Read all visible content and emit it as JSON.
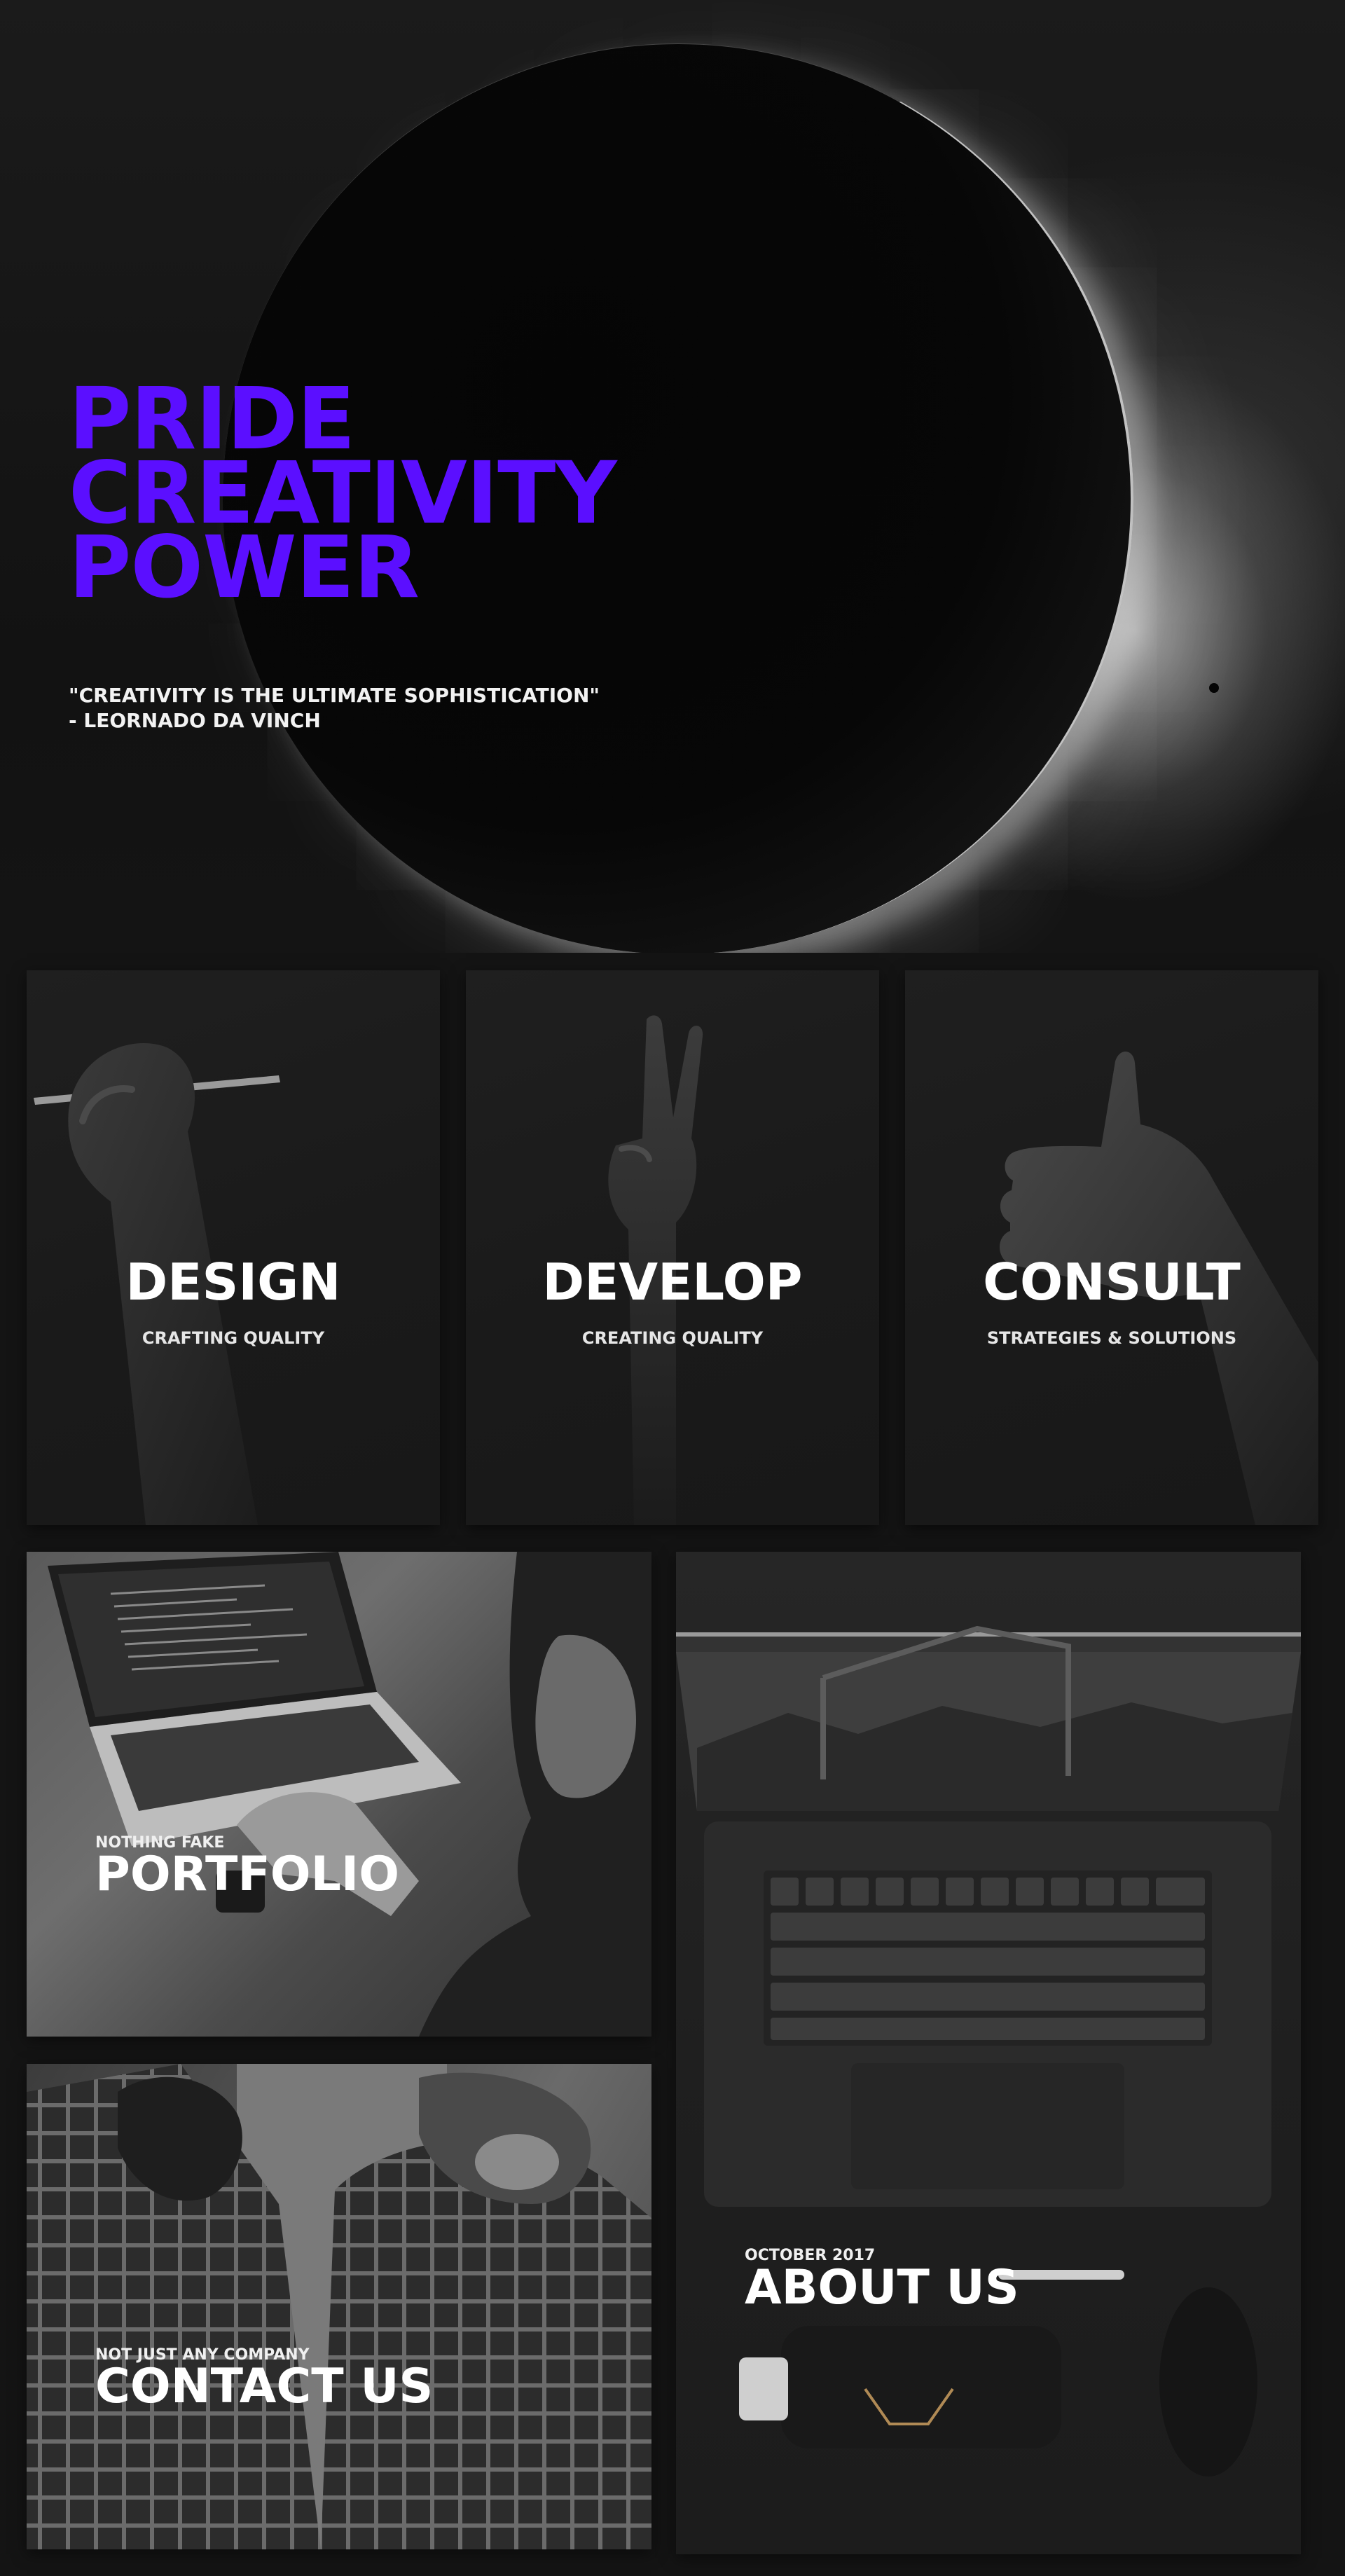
{
  "hero": {
    "title_lines": [
      "PRIDE",
      "CREATIVITY",
      "POWER"
    ],
    "quote_lines": [
      "\"CREATIVITY IS THE ULTIMATE SOPHISTICATION\"",
      "- LEORNADO DA VINCH"
    ],
    "accent_color": "#5b0fff"
  },
  "services": [
    {
      "title": "DESIGN",
      "subtitle": "CRAFTING QUALITY",
      "icon": "hand-holding-pencil"
    },
    {
      "title": "DEVELOP",
      "subtitle": "CREATING QUALITY",
      "icon": "peace-sign-hand"
    },
    {
      "title": "CONSULT",
      "subtitle": "STRATEGIES & SOLUTIONS",
      "icon": "thumbs-up-hand"
    }
  ],
  "tiles": {
    "portfolio": {
      "kicker": "NOTHING FAKE",
      "heading": "PORTFOLIO"
    },
    "contact": {
      "kicker": "NOT JUST ANY COMPANY",
      "heading": "CONTACT US"
    },
    "about": {
      "kicker": "OCTOBER 2017",
      "heading": "ABOUT US"
    }
  }
}
